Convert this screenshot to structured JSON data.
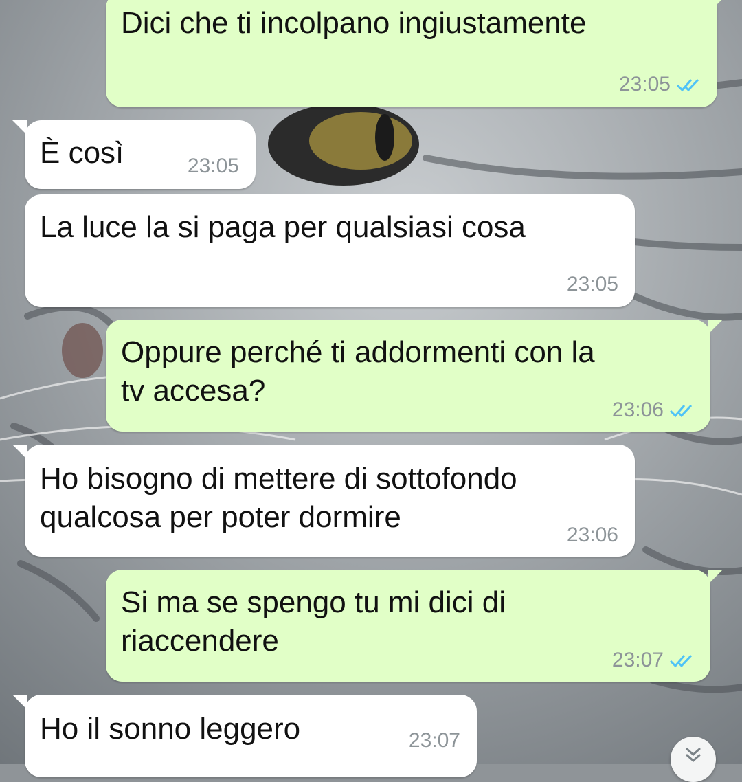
{
  "colors": {
    "outgoing_bubble": "#e1ffc7",
    "incoming_bubble": "#ffffff",
    "read_ticks": "#4fc3f7",
    "timestamp": "#8d9498"
  },
  "messages": [
    {
      "direction": "out",
      "text": "Dici che ti incolpano ingiustamente",
      "time": "23:05",
      "status": "read"
    },
    {
      "direction": "in",
      "text": "È così",
      "time": "23:05"
    },
    {
      "direction": "in",
      "text": "La luce la si paga per qualsiasi cosa",
      "time": "23:05"
    },
    {
      "direction": "out",
      "text": "Oppure perché ti addormenti con la\ntv accesa?",
      "time": "23:06",
      "status": "read"
    },
    {
      "direction": "in",
      "text": "Ho bisogno di mettere di sottofondo\nqualcosa per poter dormire",
      "time": "23:06"
    },
    {
      "direction": "out",
      "text": "Si ma se spengo tu mi dici di\nriaccendere",
      "time": "23:07",
      "status": "read"
    },
    {
      "direction": "in",
      "text": "Ho il sonno leggero",
      "time": "23:07"
    }
  ],
  "icons": {
    "read_ticks": "double-check-icon",
    "scroll_down": "double-chevron-down-icon",
    "wallpaper": "cat-wallpaper"
  }
}
